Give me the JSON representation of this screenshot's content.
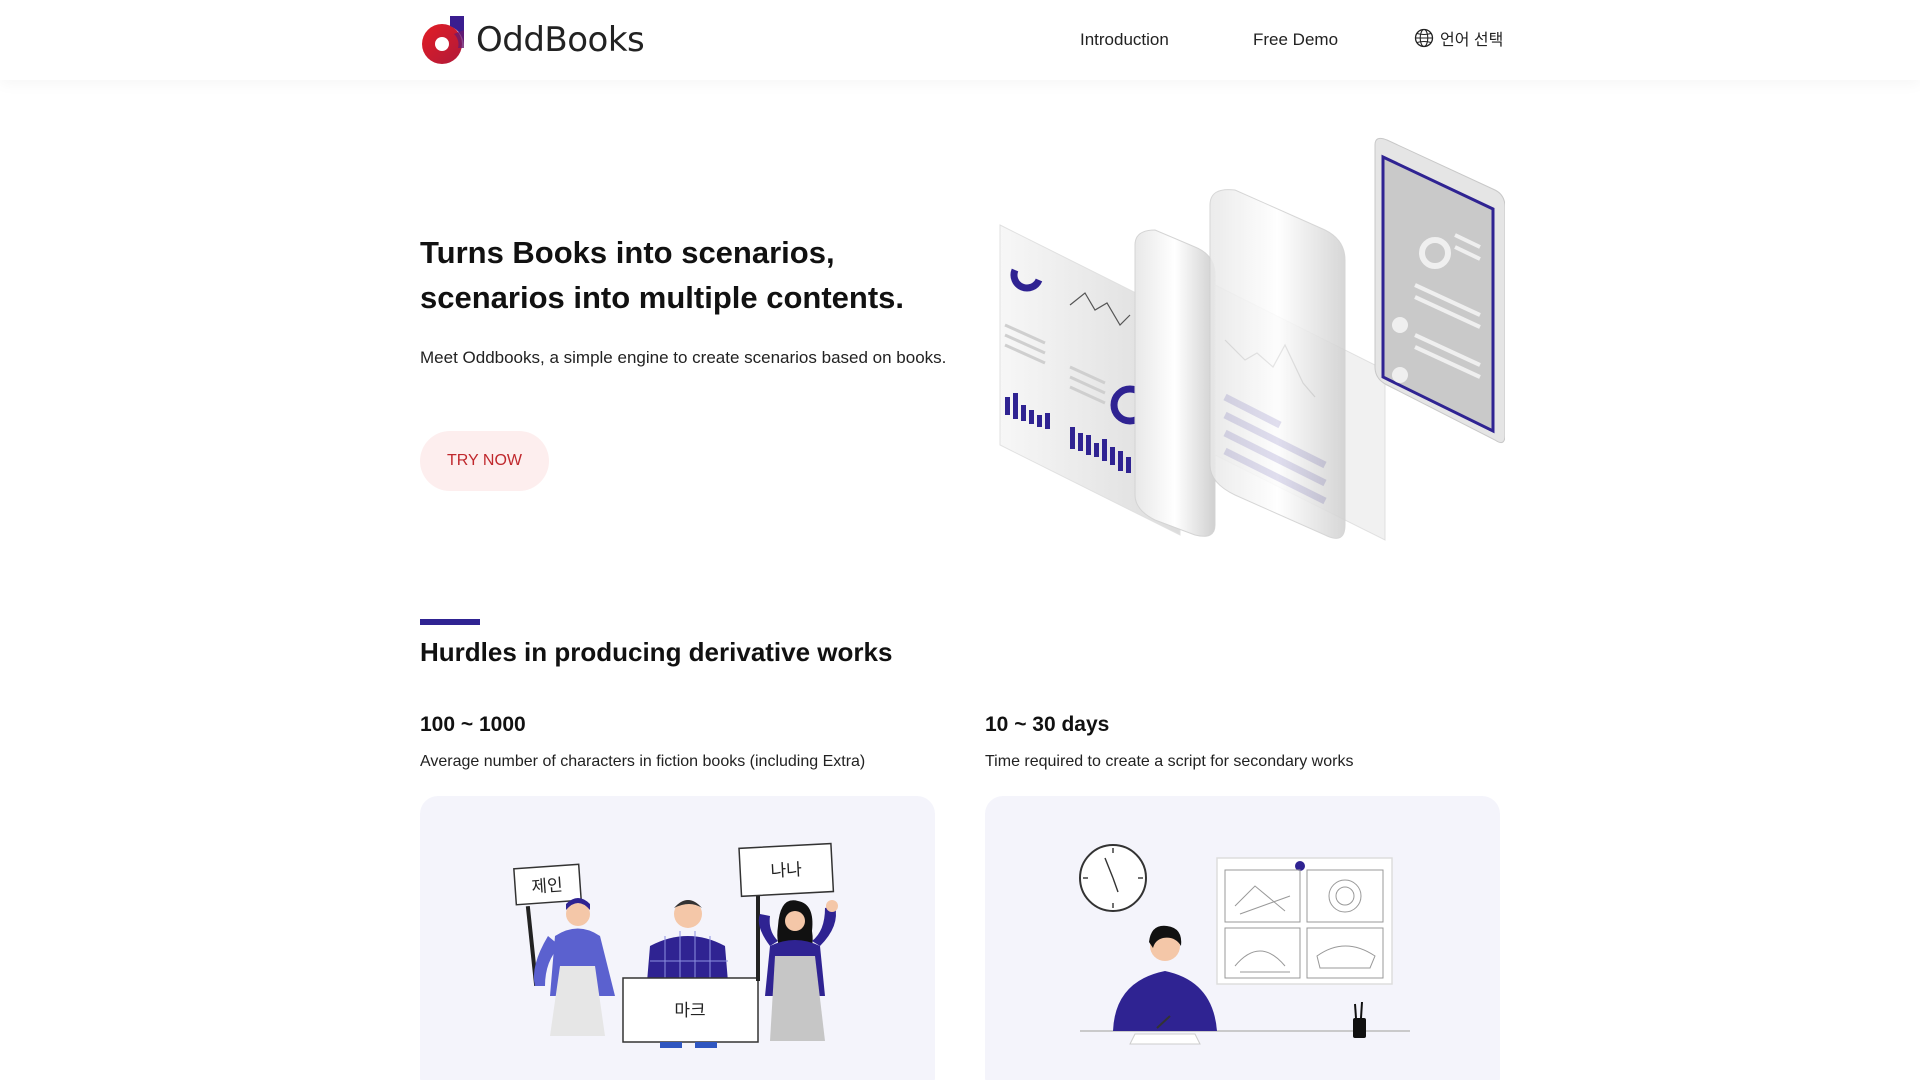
{
  "header": {
    "brand": "OddBooks",
    "nav": {
      "introduction": "Introduction",
      "free_demo": "Free Demo",
      "language": "언어 선택"
    }
  },
  "hero": {
    "title_line1": "Turns Books into scenarios,",
    "title_line2": "scenarios into multiple contents.",
    "subtitle": "Meet Oddbooks, a simple engine to create scenarios based on books.",
    "cta": "TRY NOW"
  },
  "section": {
    "title": "Hurdles in producing derivative works",
    "stats": [
      {
        "value": "100 ~ 1000",
        "description": "Average number of characters in fiction books (including Extra)"
      },
      {
        "value": "10 ~ 30 days",
        "description": "Time required to create a script for secondary works"
      }
    ],
    "cards": {
      "left_signs": [
        "제인",
        "나나",
        "마크"
      ]
    }
  },
  "colors": {
    "accent": "#2f2392",
    "brand_red": "#d81f27",
    "cta_bg": "#fdeeee",
    "cta_text": "#c0282d",
    "card_bg": "#f4f4fb"
  },
  "icons": {
    "logo": "oddbooks-logo-icon",
    "language": "globe-icon"
  }
}
